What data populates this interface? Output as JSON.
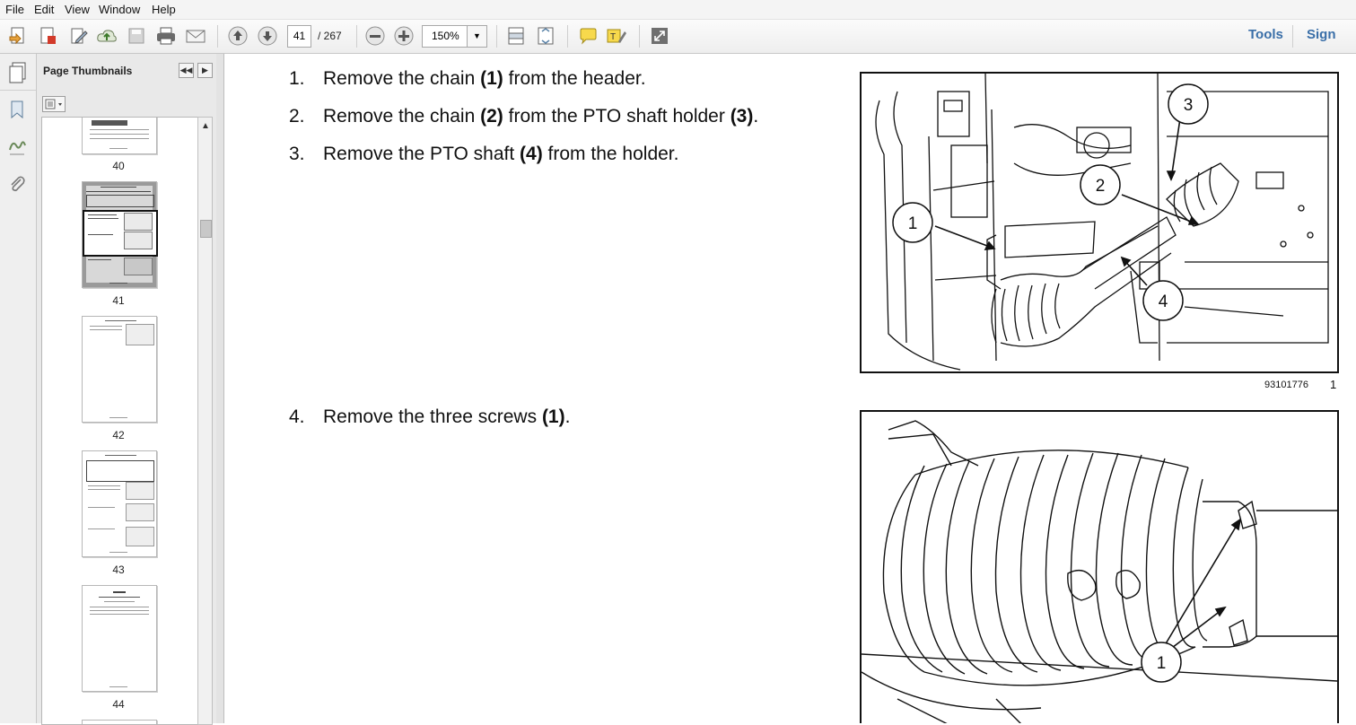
{
  "menu": [
    "File",
    "Edit",
    "View",
    "Window",
    "Help"
  ],
  "toolbar": {
    "current_page": "41",
    "total_pages": "/ 267",
    "zoom": "150%",
    "tools_label": "Tools",
    "sign_label": "Sign"
  },
  "panel": {
    "title": "Page Thumbnails",
    "thumbnails": [
      {
        "label": "40"
      },
      {
        "label": "41"
      },
      {
        "label": "42"
      },
      {
        "label": "43"
      },
      {
        "label": "44"
      }
    ]
  },
  "document": {
    "steps_group1": [
      {
        "num": "1.",
        "pre": "Remove the chain ",
        "b1": "(1)",
        "mid": " from the header.",
        "b2": "",
        "post": ""
      },
      {
        "num": "2.",
        "pre": "Remove the chain ",
        "b1": "(2)",
        "mid": " from the PTO shaft holder ",
        "b2": "(3)",
        "post": "."
      },
      {
        "num": "3.",
        "pre": "Remove the PTO shaft ",
        "b1": "(4)",
        "mid": " from the holder.",
        "b2": "",
        "post": ""
      }
    ],
    "step4": {
      "num": "4.",
      "pre": "Remove the three screws ",
      "b1": "(1)",
      "post": "."
    },
    "figure1": {
      "id": "93101776",
      "num": "1",
      "callouts": [
        "1",
        "2",
        "3",
        "4"
      ]
    },
    "figure2": {
      "callouts": [
        "1"
      ]
    }
  }
}
